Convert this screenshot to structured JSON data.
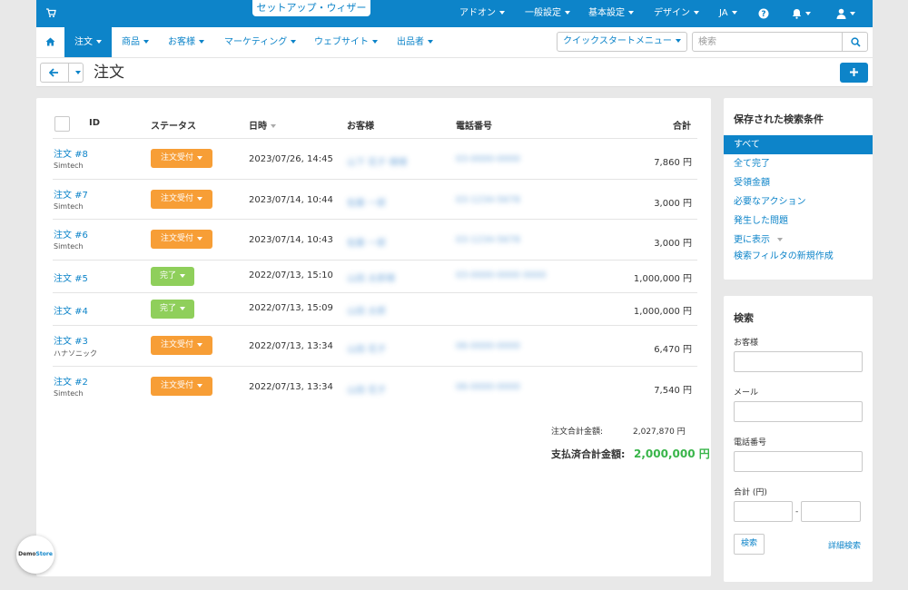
{
  "colors": {
    "primary": "#0d84c9",
    "orange_status": "#f79e36",
    "green_status": "#8fcf5b",
    "paid_total": "#39b54a"
  },
  "topbar": {
    "wizard": "セットアップ・ウィザード",
    "menus": [
      "アドオン",
      "一般設定",
      "基本設定",
      "デザイン",
      "JA"
    ],
    "icons": [
      "cart-icon",
      "help-icon",
      "bell-icon",
      "user-icon"
    ]
  },
  "mainnav": {
    "items": [
      "注文",
      "商品",
      "お客様",
      "マーケティング",
      "ウェブサイト",
      "出品者"
    ],
    "quickstart": "クイックスタートメニュー",
    "search_placeholder": "検索"
  },
  "page": {
    "title": "注文"
  },
  "table": {
    "headers": {
      "id": "ID",
      "status": "ステータス",
      "date": "日時",
      "customer": "お客様",
      "phone": "電話番号",
      "total": "合計"
    },
    "rows": [
      {
        "order": "注文 #8",
        "sub": "Simtech",
        "status": "注文受付",
        "status_color": "orange",
        "date": "2023/07/26, 14:45",
        "customer": "山下 花子 様様",
        "phone": "03-0000-0000",
        "total": "7,860 円"
      },
      {
        "order": "注文 #7",
        "sub": "Simtech",
        "status": "注文受付",
        "status_color": "orange",
        "date": "2023/07/14, 10:44",
        "customer": "佐藤 一郎",
        "phone": "03-1234-5678",
        "total": "3,000 円"
      },
      {
        "order": "注文 #6",
        "sub": "Simtech",
        "status": "注文受付",
        "status_color": "orange",
        "date": "2023/07/14, 10:43",
        "customer": "佐藤 一郎",
        "phone": "03-1234-5678",
        "total": "3,000 円"
      },
      {
        "order": "注文 #5",
        "sub": "",
        "status": "完了",
        "status_color": "green",
        "date": "2022/07/13, 15:10",
        "customer": "山田 太郎様",
        "phone": "03-0000-0000 0000",
        "total": "1,000,000 円"
      },
      {
        "order": "注文 #4",
        "sub": "",
        "status": "完了",
        "status_color": "green",
        "date": "2022/07/13, 15:09",
        "customer": "山田 太郎",
        "phone": "",
        "total": "1,000,000 円"
      },
      {
        "order": "注文 #3",
        "sub": "ハナソニック",
        "status": "注文受付",
        "status_color": "orange",
        "date": "2022/07/13, 13:34",
        "customer": "山田 花子",
        "phone": "06-0000-0000",
        "total": "6,470 円"
      },
      {
        "order": "注文 #2",
        "sub": "Simtech",
        "status": "注文受付",
        "status_color": "orange",
        "date": "2022/07/13, 13:34",
        "customer": "山田 花子",
        "phone": "06-0000-0000",
        "total": "7,540 円"
      }
    ]
  },
  "summary": {
    "order_total_label": "注文合計金額:",
    "order_total_value": "2,027,870 円",
    "paid_total_label": "支払済合計金額:",
    "paid_total_value": "2,000,000 円"
  },
  "saved_searches": {
    "title": "保存された検索条件",
    "items": [
      "すべて",
      "全て完了",
      "受領金額",
      "必要なアクション",
      "発生した問題",
      "更に表示",
      "検索フィルタの新規作成"
    ]
  },
  "search_panel": {
    "title": "検索",
    "customer_label": "お客様",
    "email_label": "メール",
    "phone_label": "電話番号",
    "total_label": "合計 (円)",
    "range_sep": "-",
    "search_button": "検索",
    "advanced_link": "詳細検索"
  },
  "demo_badge": {
    "part1": "Demo",
    "part2": "Store"
  }
}
